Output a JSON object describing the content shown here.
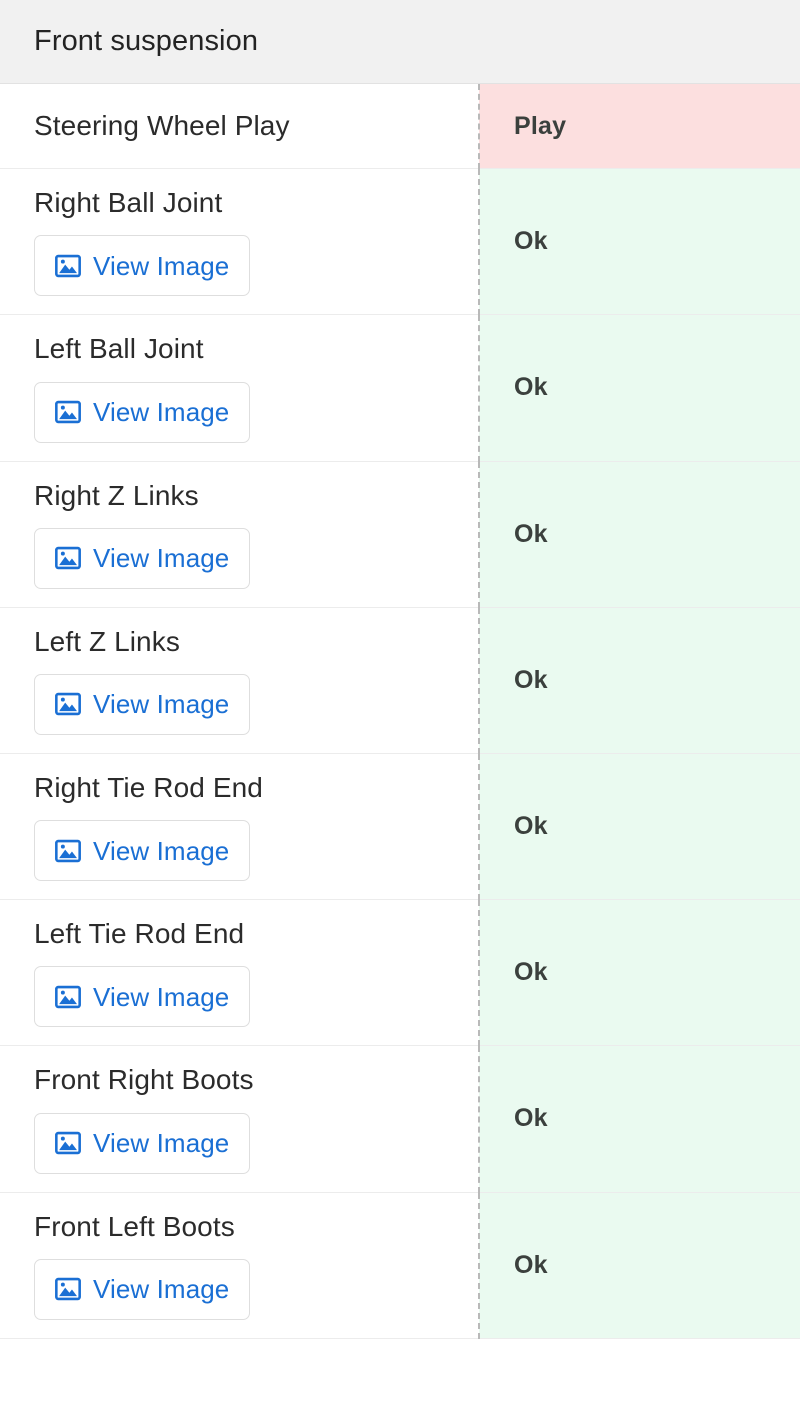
{
  "header": {
    "title": "Front suspension"
  },
  "button": {
    "view_image_label": "View Image",
    "icon": "image-icon"
  },
  "colors": {
    "header_bg": "#f1f1f1",
    "status_ok_bg": "#eafaf0",
    "status_play_bg": "#fcdfdf",
    "link_blue": "#1a6fd4",
    "status_text": "#3b403d",
    "divider_dashed": "#b9b9b9"
  },
  "rows": [
    {
      "item": "Steering Wheel Play",
      "status": "Play",
      "status_kind": "play",
      "has_image_button": false
    },
    {
      "item": "Right Ball Joint",
      "status": "Ok",
      "status_kind": "ok",
      "has_image_button": true
    },
    {
      "item": "Left Ball Joint",
      "status": "Ok",
      "status_kind": "ok",
      "has_image_button": true
    },
    {
      "item": "Right Z Links",
      "status": "Ok",
      "status_kind": "ok",
      "has_image_button": true
    },
    {
      "item": "Left Z Links",
      "status": "Ok",
      "status_kind": "ok",
      "has_image_button": true
    },
    {
      "item": "Right Tie Rod End",
      "status": "Ok",
      "status_kind": "ok",
      "has_image_button": true
    },
    {
      "item": "Left Tie Rod End",
      "status": "Ok",
      "status_kind": "ok",
      "has_image_button": true
    },
    {
      "item": "Front Right Boots",
      "status": "Ok",
      "status_kind": "ok",
      "has_image_button": true
    },
    {
      "item": "Front Left Boots",
      "status": "Ok",
      "status_kind": "ok",
      "has_image_button": true
    }
  ]
}
